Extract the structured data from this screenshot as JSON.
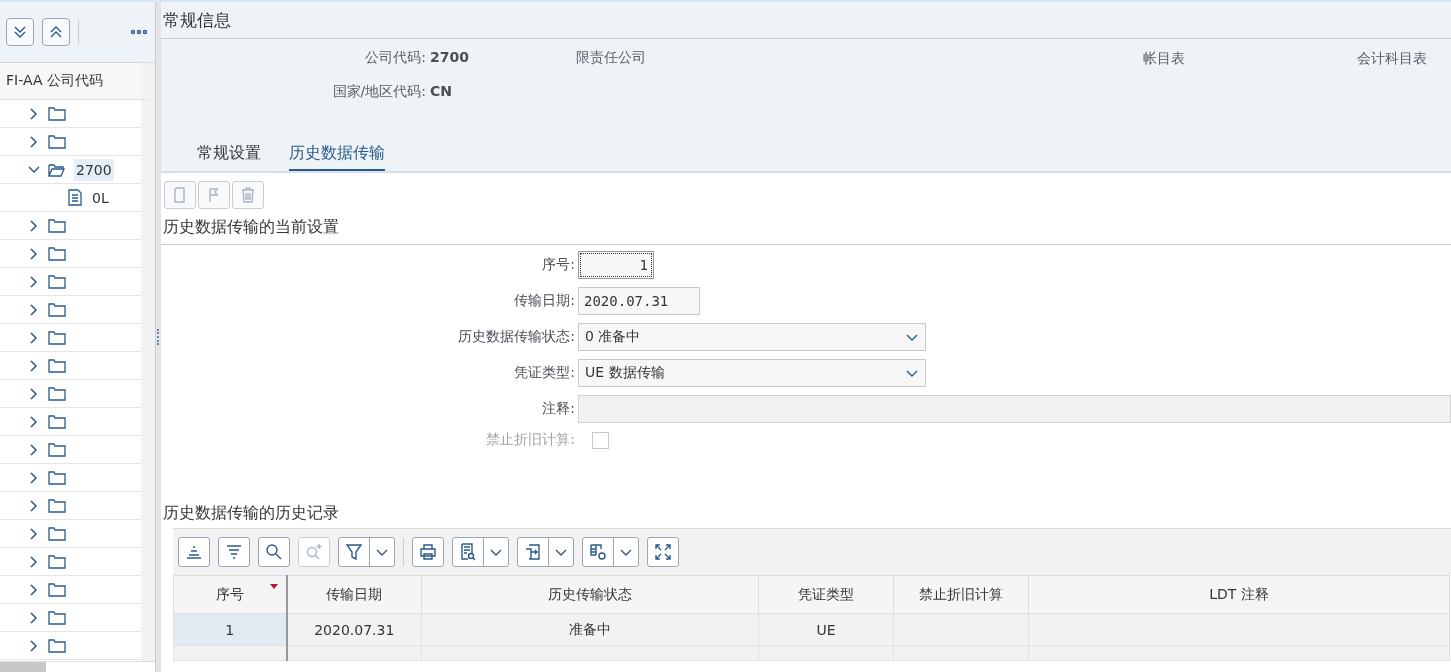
{
  "sidebar": {
    "toolbar": [
      {
        "kind": "expand-all"
      },
      {
        "kind": "collapse-all"
      },
      {
        "kind": "more"
      }
    ],
    "tree_header": "FI-AA 公司代码",
    "tree": [
      {
        "expanded": false
      },
      {
        "expanded": false
      },
      {
        "expanded": true,
        "selected": true,
        "label": "2700",
        "children": [
          {
            "label": "0L",
            "selected": false
          }
        ]
      },
      {
        "expanded": false
      },
      {
        "expanded": false
      },
      {
        "expanded": false
      },
      {
        "expanded": false
      },
      {
        "expanded": false
      },
      {
        "expanded": false
      },
      {
        "expanded": false
      },
      {
        "expanded": false
      },
      {
        "expanded": false
      },
      {
        "expanded": false
      },
      {
        "expanded": false
      },
      {
        "expanded": false
      },
      {
        "expanded": false
      },
      {
        "expanded": false
      },
      {
        "expanded": false
      },
      {
        "expanded": false
      }
    ]
  },
  "header": {
    "title": "常规信息",
    "fields": [
      {
        "label": "公司代码:",
        "value": "2700",
        "extra": "限责任公司"
      },
      {
        "label": "国家/地区代码:",
        "value": "CN"
      }
    ],
    "right_field": {
      "label": "帐目表",
      "extra": "会计科目表"
    },
    "tabs": [
      {
        "label": "常规设置",
        "selected": false
      },
      {
        "label": "历史数据传输",
        "selected": true
      }
    ]
  },
  "toolbar": [
    {
      "kind": "new",
      "disabled": true
    },
    {
      "kind": "flag",
      "disabled": true
    },
    {
      "kind": "delete",
      "disabled": true
    }
  ],
  "settings": {
    "title": "历史数据传输的当前设置",
    "fields": [
      {
        "kind": "number",
        "label": "序号:",
        "value": "1",
        "focused": true,
        "disabled": false
      },
      {
        "kind": "input",
        "label": "传输日期:",
        "value": "2020.07.31",
        "focused": false,
        "disabled": false
      },
      {
        "kind": "select",
        "label": "历史数据传输状态:",
        "value": "0 准备中",
        "disabled": false
      },
      {
        "kind": "select",
        "label": "凭证类型:",
        "value": "UE 数据传输",
        "disabled": false
      },
      {
        "kind": "input",
        "label": "注释:",
        "focused": false,
        "disabled": true
      },
      {
        "kind": "checkbox",
        "label": "禁止折旧计算:",
        "checked": false,
        "disabled": true
      }
    ]
  },
  "history": {
    "title": "历史数据传输的历史记录",
    "toolbar": [
      {
        "kind": "sort-asc",
        "menu": false,
        "disabled": false
      },
      {
        "kind": "sort-desc",
        "menu": false,
        "disabled": false
      },
      {
        "kind": "search",
        "menu": false,
        "disabled": false
      },
      {
        "kind": "search-next",
        "menu": false,
        "disabled": true
      },
      {
        "kind": "filter",
        "menu": true,
        "disabled": false
      },
      {
        "kind": "sep"
      },
      {
        "kind": "print",
        "menu": false,
        "disabled": false
      },
      {
        "kind": "view",
        "menu": true,
        "disabled": false
      },
      {
        "kind": "export",
        "menu": true,
        "disabled": false
      },
      {
        "kind": "layout",
        "menu": true,
        "disabled": false
      },
      {
        "kind": "fullscreen",
        "menu": false,
        "disabled": false
      }
    ],
    "columns": [
      {
        "label": "序号",
        "sorted": true
      },
      {
        "label": "传输日期",
        "sorted": false
      },
      {
        "label": "历史传输状态",
        "sorted": false
      },
      {
        "label": "凭证类型",
        "sorted": false
      },
      {
        "label": "禁止折旧计算",
        "sorted": false
      },
      {
        "label": "LDT 注释",
        "sorted": false
      }
    ],
    "rows": [
      [
        "1",
        "2020.07.31",
        "准备中",
        "UE",
        "",
        ""
      ]
    ]
  }
}
